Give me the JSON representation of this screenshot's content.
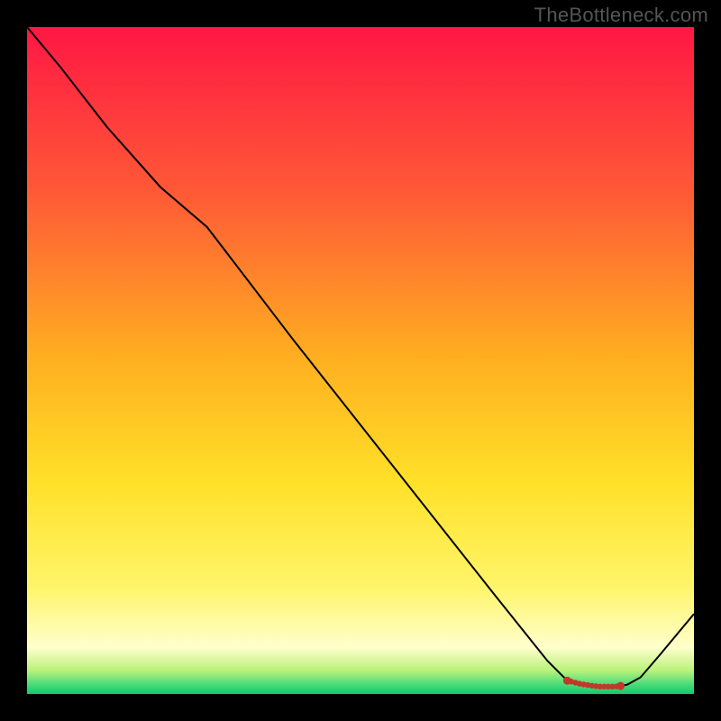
{
  "watermark": "TheBottleneck.com",
  "chart_data": {
    "type": "line",
    "title": "",
    "xlabel": "",
    "ylabel": "",
    "xlim": [
      0,
      100
    ],
    "ylim": [
      0,
      100
    ],
    "grid": false,
    "background_gradient": {
      "stops": [
        {
          "offset": 0.0,
          "color": "#ff1744"
        },
        {
          "offset": 0.25,
          "color": "#ff5a36"
        },
        {
          "offset": 0.5,
          "color": "#ffb020"
        },
        {
          "offset": 0.68,
          "color": "#ffe028"
        },
        {
          "offset": 0.84,
          "color": "#fff56a"
        },
        {
          "offset": 0.93,
          "color": "#ffffcc"
        },
        {
          "offset": 0.965,
          "color": "#b8f27a"
        },
        {
          "offset": 0.985,
          "color": "#4ddc7a"
        },
        {
          "offset": 1.0,
          "color": "#18c76a"
        }
      ]
    },
    "x": [
      0,
      5,
      12,
      20,
      27,
      40,
      55,
      70,
      78,
      81,
      83,
      85,
      86,
      87,
      88,
      89,
      90,
      92,
      95,
      100
    ],
    "values": [
      100,
      94,
      85,
      76,
      70,
      53,
      34,
      15,
      5,
      2,
      1.5,
      1.2,
      1.1,
      1.1,
      1.1,
      1.2,
      1.4,
      2.5,
      6,
      12
    ],
    "flat_region": {
      "x_start": 81,
      "x_end": 89,
      "marker_color": "#c0392b"
    },
    "line_color": "#000000",
    "line_width": 2
  }
}
